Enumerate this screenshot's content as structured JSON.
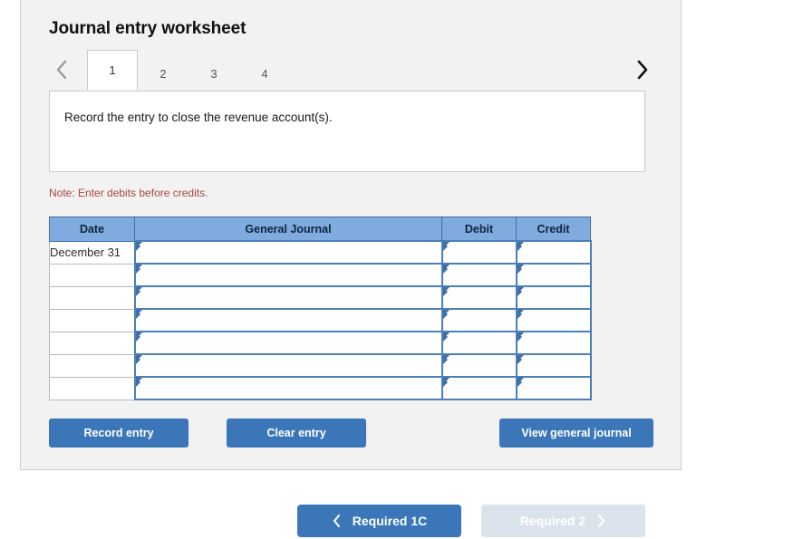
{
  "worksheet": {
    "title": "Journal entry worksheet",
    "tabs": [
      {
        "label": "1",
        "active": true
      },
      {
        "label": "2",
        "active": false
      },
      {
        "label": "3",
        "active": false
      },
      {
        "label": "4",
        "active": false
      }
    ],
    "prev_arrow_icon": "chevron-left-icon",
    "next_arrow_icon": "chevron-right-icon",
    "description": "Record the entry to close the revenue account(s).",
    "note": "Note: Enter debits before credits.",
    "table": {
      "columns": [
        "Date",
        "General Journal",
        "Debit",
        "Credit"
      ],
      "rows": [
        {
          "date": "December 31",
          "general_journal": "",
          "debit": "",
          "credit": ""
        },
        {
          "date": "",
          "general_journal": "",
          "debit": "",
          "credit": ""
        },
        {
          "date": "",
          "general_journal": "",
          "debit": "",
          "credit": ""
        },
        {
          "date": "",
          "general_journal": "",
          "debit": "",
          "credit": ""
        },
        {
          "date": "",
          "general_journal": "",
          "debit": "",
          "credit": ""
        },
        {
          "date": "",
          "general_journal": "",
          "debit": "",
          "credit": ""
        },
        {
          "date": "",
          "general_journal": "",
          "debit": "",
          "credit": ""
        }
      ]
    },
    "buttons": {
      "record_entry": "Record entry",
      "clear_entry": "Clear entry",
      "view_general_journal": "View general journal"
    }
  },
  "bottom_nav": {
    "prev_label": "Required 1C",
    "next_label": "Required 2",
    "prev_icon": "chevron-left-icon",
    "next_icon": "chevron-right-icon"
  },
  "colors": {
    "panel_background": "#f2f2f2",
    "primary_button": "#3a76b8",
    "disabled_button": "#dbe3ed",
    "table_header": "#7fabdf",
    "table_header_border": "#3f6fa8",
    "input_border": "#4a7fb8",
    "note_text": "#a94442"
  }
}
